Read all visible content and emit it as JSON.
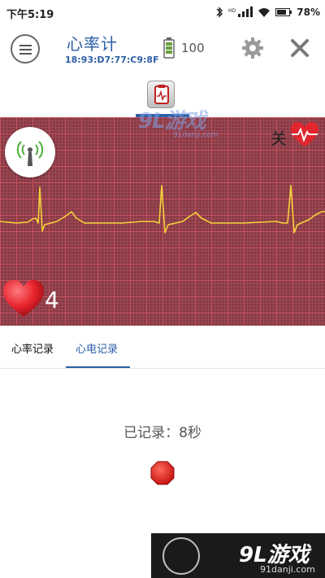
{
  "status_bar": {
    "time": "下午5:19",
    "battery_percent": "78%"
  },
  "header": {
    "title": "心率计",
    "device_mac": "18:93:D7:77:C9:8F",
    "battery_level": "100"
  },
  "ecg_panel": {
    "toggle_label": "关",
    "heart_rate_value": "4"
  },
  "tabs": [
    {
      "label": "心率记录",
      "selected": false
    },
    {
      "label": "心电记录",
      "selected": true
    }
  ],
  "content": {
    "recorded_text": "已记录：8秒"
  },
  "watermarks": {
    "top_brand": "9L游戏",
    "top_url": "91danji.com",
    "bottom_brand": "9L游戏",
    "bottom_url": "91danji.com"
  },
  "colors": {
    "accent": "#2b5fa6",
    "ecg_background": "#8b3a45",
    "trace": "#f5d23a",
    "stop": "#d91a1a"
  },
  "icons": {
    "menu": "menu-icon",
    "battery": "battery-icon",
    "settings": "gear-icon",
    "close": "close-icon",
    "record": "clipboard-ecg-icon",
    "signal": "antenna-icon",
    "heartbeat": "heartbeat-icon",
    "heart": "heart-icon",
    "stop": "stop-icon"
  }
}
